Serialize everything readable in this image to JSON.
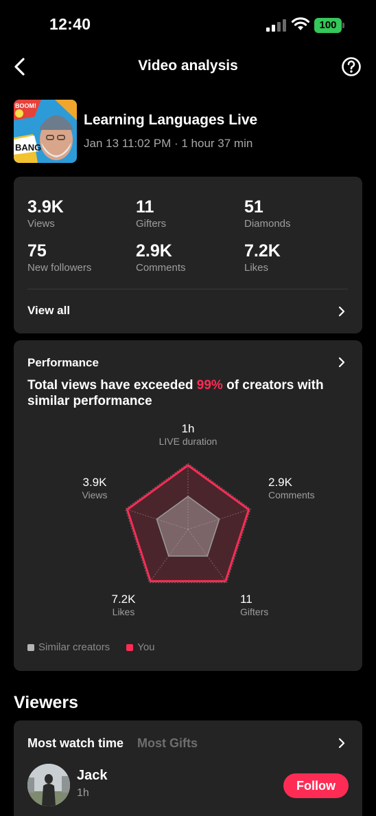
{
  "status_bar": {
    "time": "12:40",
    "battery": "100"
  },
  "header": {
    "title": "Video analysis"
  },
  "live": {
    "title": "Learning Languages Live",
    "meta": "Jan 13 11:02 PM · 1 hour 37 min"
  },
  "stats": [
    {
      "value": "3.9K",
      "label": "Views"
    },
    {
      "value": "11",
      "label": "Gifters"
    },
    {
      "value": "51",
      "label": "Diamonds"
    },
    {
      "value": "75",
      "label": "New followers"
    },
    {
      "value": "2.9K",
      "label": "Comments"
    },
    {
      "value": "7.2K",
      "label": "Likes"
    }
  ],
  "view_all_label": "View all",
  "performance": {
    "title": "Performance",
    "headline_before": "Total views have exceeded ",
    "headline_highlight": "99%",
    "headline_after": " of creators with similar performance",
    "radar": {
      "axes": [
        {
          "value": "1h",
          "label": "LIVE duration"
        },
        {
          "value": "2.9K",
          "label": "Comments"
        },
        {
          "value": "11",
          "label": "Gifters"
        },
        {
          "value": "7.2K",
          "label": "Likes"
        },
        {
          "value": "3.9K",
          "label": "Views"
        }
      ],
      "you_scores": [
        0.97,
        0.97,
        0.97,
        0.97,
        0.97
      ],
      "similar_scores": [
        0.5,
        0.5,
        0.5,
        0.5,
        0.5
      ]
    },
    "legend": {
      "similar": "Similar creators",
      "you": "You"
    },
    "colors": {
      "you": "#fe2c55",
      "similar": "#9a9a9a"
    }
  },
  "viewers": {
    "title": "Viewers",
    "tabs": [
      "Most watch time",
      "Most Gifts"
    ],
    "list": [
      {
        "name": "Jack",
        "time": "1h",
        "action": "Follow"
      }
    ]
  }
}
